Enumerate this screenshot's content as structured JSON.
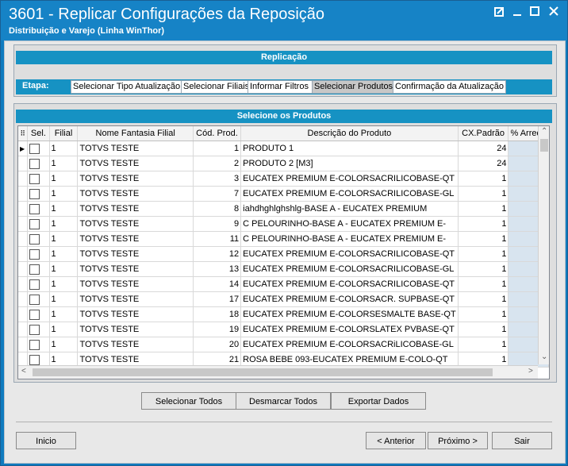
{
  "window": {
    "title": "3601 - Replicar Configurações da Reposição",
    "subtitle": "Distribuição e Varejo (Linha WinThor)",
    "controls": [
      "restore-icon",
      "minimize-icon",
      "maximize-icon",
      "close-icon"
    ]
  },
  "replicacao": {
    "label": "Replicação"
  },
  "etapa": {
    "label": "Etapa:",
    "steps": [
      {
        "label": "Selecionar Tipo Atualização"
      },
      {
        "label": "Selecionar Filiais"
      },
      {
        "label": "Informar Filtros"
      },
      {
        "label": "Selecionar Produtos"
      },
      {
        "label": "Confirmação da Atualização"
      }
    ],
    "active_index": 3
  },
  "grid": {
    "title": "Selecione os Produtos",
    "columns": [
      "Sel.",
      "Filial",
      "Nome Fantasia Filial",
      "Cód. Prod.",
      "Descrição do Produto",
      "CX.Padrão",
      "% Arred"
    ],
    "rows": [
      {
        "filial": "1",
        "nome": "TOTVS TESTE",
        "cod": "1",
        "desc": "PRODUTO 1",
        "cx": "24"
      },
      {
        "filial": "1",
        "nome": "TOTVS TESTE",
        "cod": "2",
        "desc": "PRODUTO 2 [M3]",
        "cx": "24"
      },
      {
        "filial": "1",
        "nome": "TOTVS TESTE",
        "cod": "3",
        "desc": "EUCATEX PREMIUM E-COLORSACRILICOBASE-QT",
        "cx": "1"
      },
      {
        "filial": "1",
        "nome": "TOTVS TESTE",
        "cod": "7",
        "desc": "EUCATEX PREMIUM E-COLORSACRILICOBASE-GL",
        "cx": "1"
      },
      {
        "filial": "1",
        "nome": "TOTVS TESTE",
        "cod": "8",
        "desc": "iahdhghlghshlg-BASE A - EUCATEX PREMIUM",
        "cx": "1"
      },
      {
        "filial": "1",
        "nome": "TOTVS TESTE",
        "cod": "9",
        "desc": "C PELOURINHO-BASE A - EUCATEX PREMIUM E-",
        "cx": "1"
      },
      {
        "filial": "1",
        "nome": "TOTVS TESTE",
        "cod": "11",
        "desc": "C PELOURINHO-BASE A - EUCATEX PREMIUM E-",
        "cx": "1"
      },
      {
        "filial": "1",
        "nome": "TOTVS TESTE",
        "cod": "12",
        "desc": "EUCATEX PREMIUM E-COLORSACRILICOBASE-QT",
        "cx": "1"
      },
      {
        "filial": "1",
        "nome": "TOTVS TESTE",
        "cod": "13",
        "desc": "EUCATEX PREMIUM E-COLORSACRILICOBASE-GL",
        "cx": "1"
      },
      {
        "filial": "1",
        "nome": "TOTVS TESTE",
        "cod": "14",
        "desc": "EUCATEX PREMIUM E-COLORSACRILICOBASE-QT",
        "cx": "1"
      },
      {
        "filial": "1",
        "nome": "TOTVS TESTE",
        "cod": "17",
        "desc": "EUCATEX PREMIUM E-COLORSACR. SUPBASE-QT",
        "cx": "1"
      },
      {
        "filial": "1",
        "nome": "TOTVS TESTE",
        "cod": "18",
        "desc": "EUCATEX PREMIUM E-COLORSESMALTE BASE-QT",
        "cx": "1"
      },
      {
        "filial": "1",
        "nome": "TOTVS TESTE",
        "cod": "19",
        "desc": "EUCATEX PREMIUM E-COLORSLATEX PVBASE-QT",
        "cx": "1"
      },
      {
        "filial": "1",
        "nome": "TOTVS TESTE",
        "cod": "20",
        "desc": "EUCATEX PREMIUM E-COLORSACRiLICOBASE-GL",
        "cx": "1"
      },
      {
        "filial": "1",
        "nome": "TOTVS TESTE",
        "cod": "21",
        "desc": "ROSA BEBE 093-EUCATEX PREMIUM E-COLO-QT",
        "cx": "1"
      }
    ]
  },
  "actions": {
    "select_all": "Selecionar Todos",
    "deselect_all": "Desmarcar Todos",
    "export": "Exportar Dados"
  },
  "nav": {
    "start": "Inicio",
    "back": "< Anterior",
    "next": "Próximo >",
    "exit": "Sair"
  },
  "colors": {
    "title_bar": "#1683c6",
    "band": "#1692c3"
  }
}
